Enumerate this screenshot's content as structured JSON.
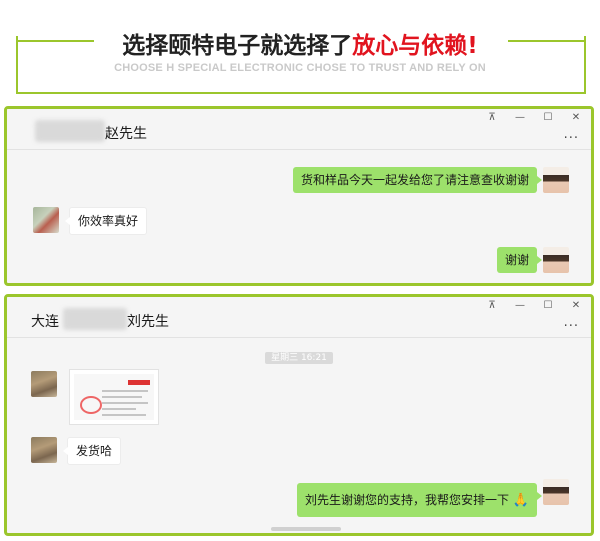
{
  "banner": {
    "title_main": "选择颐特电子就选择了",
    "title_red": "放心与依赖!",
    "subtitle": "CHOOSE H SPECIAL ELECTRONIC CHOSE TO TRUST AND RELY ON",
    "accent_color": "#9bc62c",
    "red_color": "#e1141f"
  },
  "window_controls": {
    "pin": "⊼",
    "minimize": "—",
    "maximize": "☐",
    "close": "✕",
    "more": "···"
  },
  "chat1": {
    "contact_name": "赵先生",
    "messages": [
      {
        "from": "me",
        "text": "货和样品今天一起发给您了请注意查收谢谢"
      },
      {
        "from": "them",
        "text": "你效率真好"
      },
      {
        "from": "me",
        "text": "谢谢"
      }
    ]
  },
  "chat2": {
    "contact_prefix": "大连",
    "contact_name": "刘先生",
    "timestamp": "星期三 16:21",
    "messages": [
      {
        "from": "them",
        "type": "image"
      },
      {
        "from": "them",
        "text": "发货哈"
      },
      {
        "from": "me",
        "text": "刘先生谢谢您的支持，我帮您安排一下",
        "emoji": "🙏"
      }
    ]
  },
  "icons": [
    "pin-icon",
    "minimize-icon",
    "maximize-icon",
    "close-icon",
    "more-icon",
    "avatar"
  ]
}
